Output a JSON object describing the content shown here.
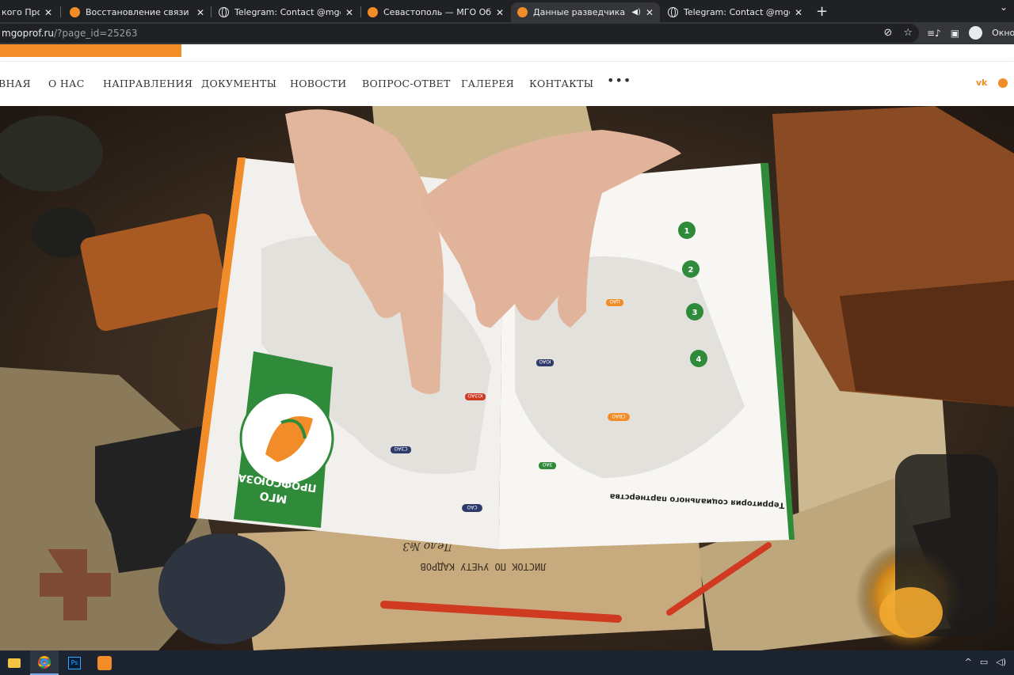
{
  "browser": {
    "tabs": [
      {
        "title": "кого Профсо",
        "favicon": "orange-circle-icon",
        "active": false
      },
      {
        "title": "Восстановление связи — МГО С",
        "favicon": "orange-circle-icon",
        "active": false
      },
      {
        "title": "Telegram: Contact @mgoprof_ru",
        "favicon": "globe-icon",
        "active": false
      },
      {
        "title": "Севастополь — МГО Общеросс",
        "favicon": "orange-circle-icon",
        "active": false
      },
      {
        "title": "Данные разведчика — МГО",
        "favicon": "orange-circle-icon",
        "active": true
      },
      {
        "title": "Telegram: Contact @mgoprof_ru",
        "favicon": "globe-icon",
        "active": false
      }
    ],
    "address": {
      "host": "mgoprof.ru",
      "path": "/?page_id=25263"
    },
    "incognito_label": "Окно в р"
  },
  "site": {
    "accent_color": "#f28c28",
    "nav": {
      "items": [
        "ВНАЯ",
        "О НАС",
        "НАПРАВЛЕНИЯ",
        "ДОКУМЕНТЫ",
        "НОВОСТИ",
        "ВОПРОС-ОТВЕТ",
        "ГАЛЕРЕЯ",
        "КОНТАКТЫ"
      ],
      "more": "•••",
      "social": {
        "vk": "vk"
      }
    }
  },
  "hero": {
    "brochure": {
      "logo_text_line1": "МГО",
      "logo_text_line2": "ПРОФСОЮЗА",
      "heading": "Территория социального партнерства",
      "map_badges": [
        "САО",
        "ЮАО",
        "ЮЗАО",
        "ЦАО",
        "СВАО",
        "ЗАО",
        "СЗАО"
      ],
      "numbers": [
        "1",
        "2",
        "3",
        "4"
      ]
    },
    "papers": {
      "title": "ЛИСТОК ПО УЧЕТУ КАДРОВ",
      "stamp": "Дело №3"
    }
  },
  "taskbar": {
    "apps": [
      "file-explorer-icon",
      "chrome-icon",
      "photoshop-icon",
      "app-icon"
    ]
  }
}
